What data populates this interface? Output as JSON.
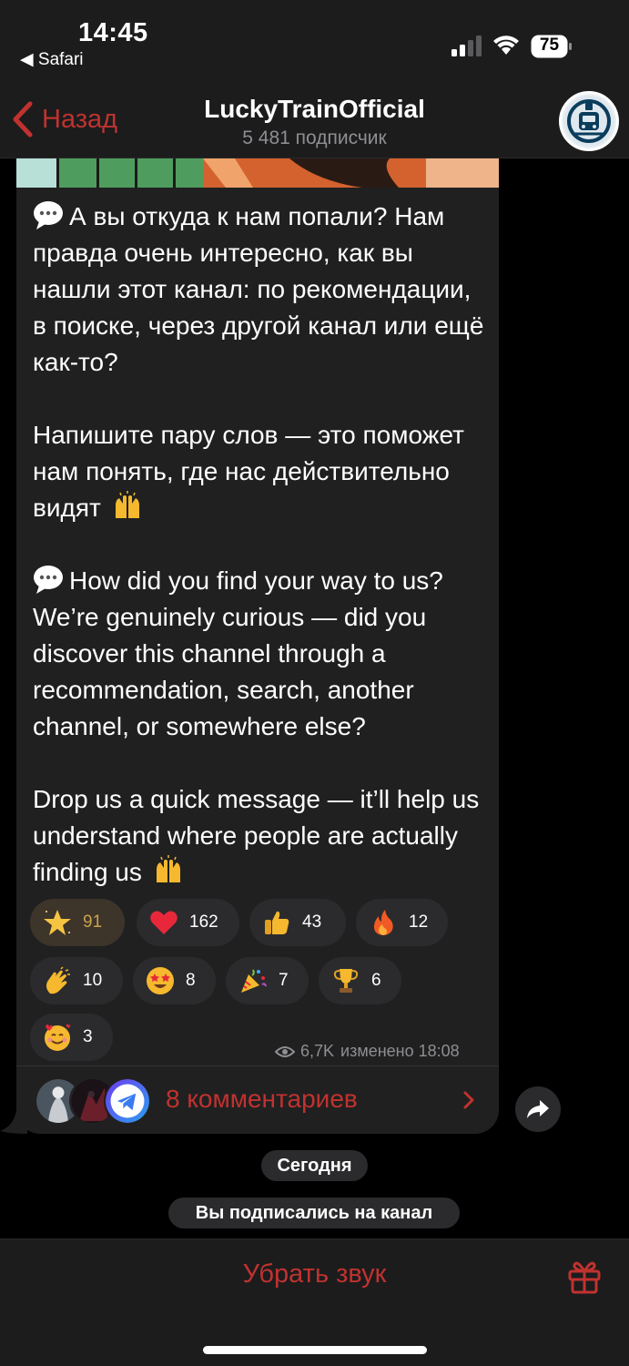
{
  "status_bar": {
    "time": "14:45",
    "back_app": "◀ Safari",
    "battery": "75"
  },
  "nav": {
    "back_label": "Назад",
    "title": "LuckyTrainOfficial",
    "subtitle": "5 481 подписчик",
    "avatar_icon": "train-logo-icon"
  },
  "message": {
    "paragraphs": [
      "А вы откуда к нам попали? Нам правда очень интересно, как вы нашли этот канал: по рекомендации, в поиске, через другой канал или ещё как-то?",
      "Напишите пару слов — это поможет нам понять, где нас действительно видят",
      "How did you find your way to us? We’re genuinely curious — did you discover this channel through a recommendation, search, another channel, or somewhere else?",
      "Drop us a quick message — it’ll help us understand where people are actually finding us"
    ]
  },
  "reactions": [
    {
      "icon": "star-icon",
      "count": "91"
    },
    {
      "icon": "heart-icon",
      "count": "162"
    },
    {
      "icon": "thumbs-up-icon",
      "count": "43"
    },
    {
      "icon": "fire-icon",
      "count": "12"
    },
    {
      "icon": "clapping-hands-icon",
      "count": "10"
    },
    {
      "icon": "star-struck-icon",
      "count": "8"
    },
    {
      "icon": "party-popper-icon",
      "count": "7"
    },
    {
      "icon": "trophy-icon",
      "count": "6"
    },
    {
      "icon": "smiling-face-hearts-icon",
      "count": "3"
    }
  ],
  "meta": {
    "views": "6,7K",
    "edited": "изменено 18:08"
  },
  "comments": {
    "label": "8 комментариев"
  },
  "date_pill": "Сегодня",
  "service_message": "Вы подписались на канал",
  "bottom": {
    "mute_label": "Убрать звук"
  },
  "colors": {
    "accent": "#c0322f",
    "bubble": "#202020",
    "background": "#000000"
  }
}
